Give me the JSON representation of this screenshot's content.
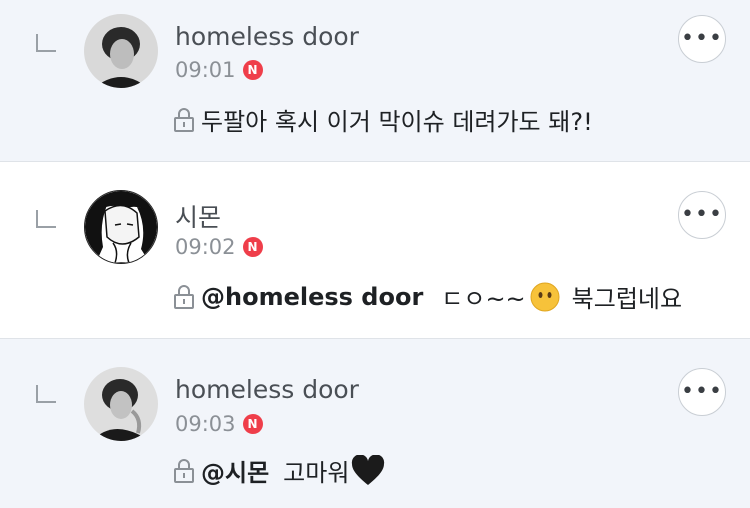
{
  "comments": [
    {
      "author": "homeless door",
      "time": "09:01",
      "badge": "N",
      "mention": "",
      "text": "두팔아 혹시 이거 막이슈 데려가도 돼?!",
      "more": "•••"
    },
    {
      "author": "시몬",
      "time": "09:02",
      "badge": "N",
      "mention": "@homeless door",
      "text_before_emoji": "ㄷㅇ~~",
      "emoji": "no-mouth-face-emoji",
      "text_after_emoji": "북그럽네요",
      "more": "•••"
    },
    {
      "author": "homeless door",
      "time": "09:03",
      "badge": "N",
      "mention": "@시몬",
      "text": "고마워",
      "emoji": "black-heart-emoji",
      "more": "•••"
    }
  ],
  "colors": {
    "highlight_bg": "#f2f5fa",
    "badge": "#ef3e4a",
    "time": "#8b9096"
  }
}
